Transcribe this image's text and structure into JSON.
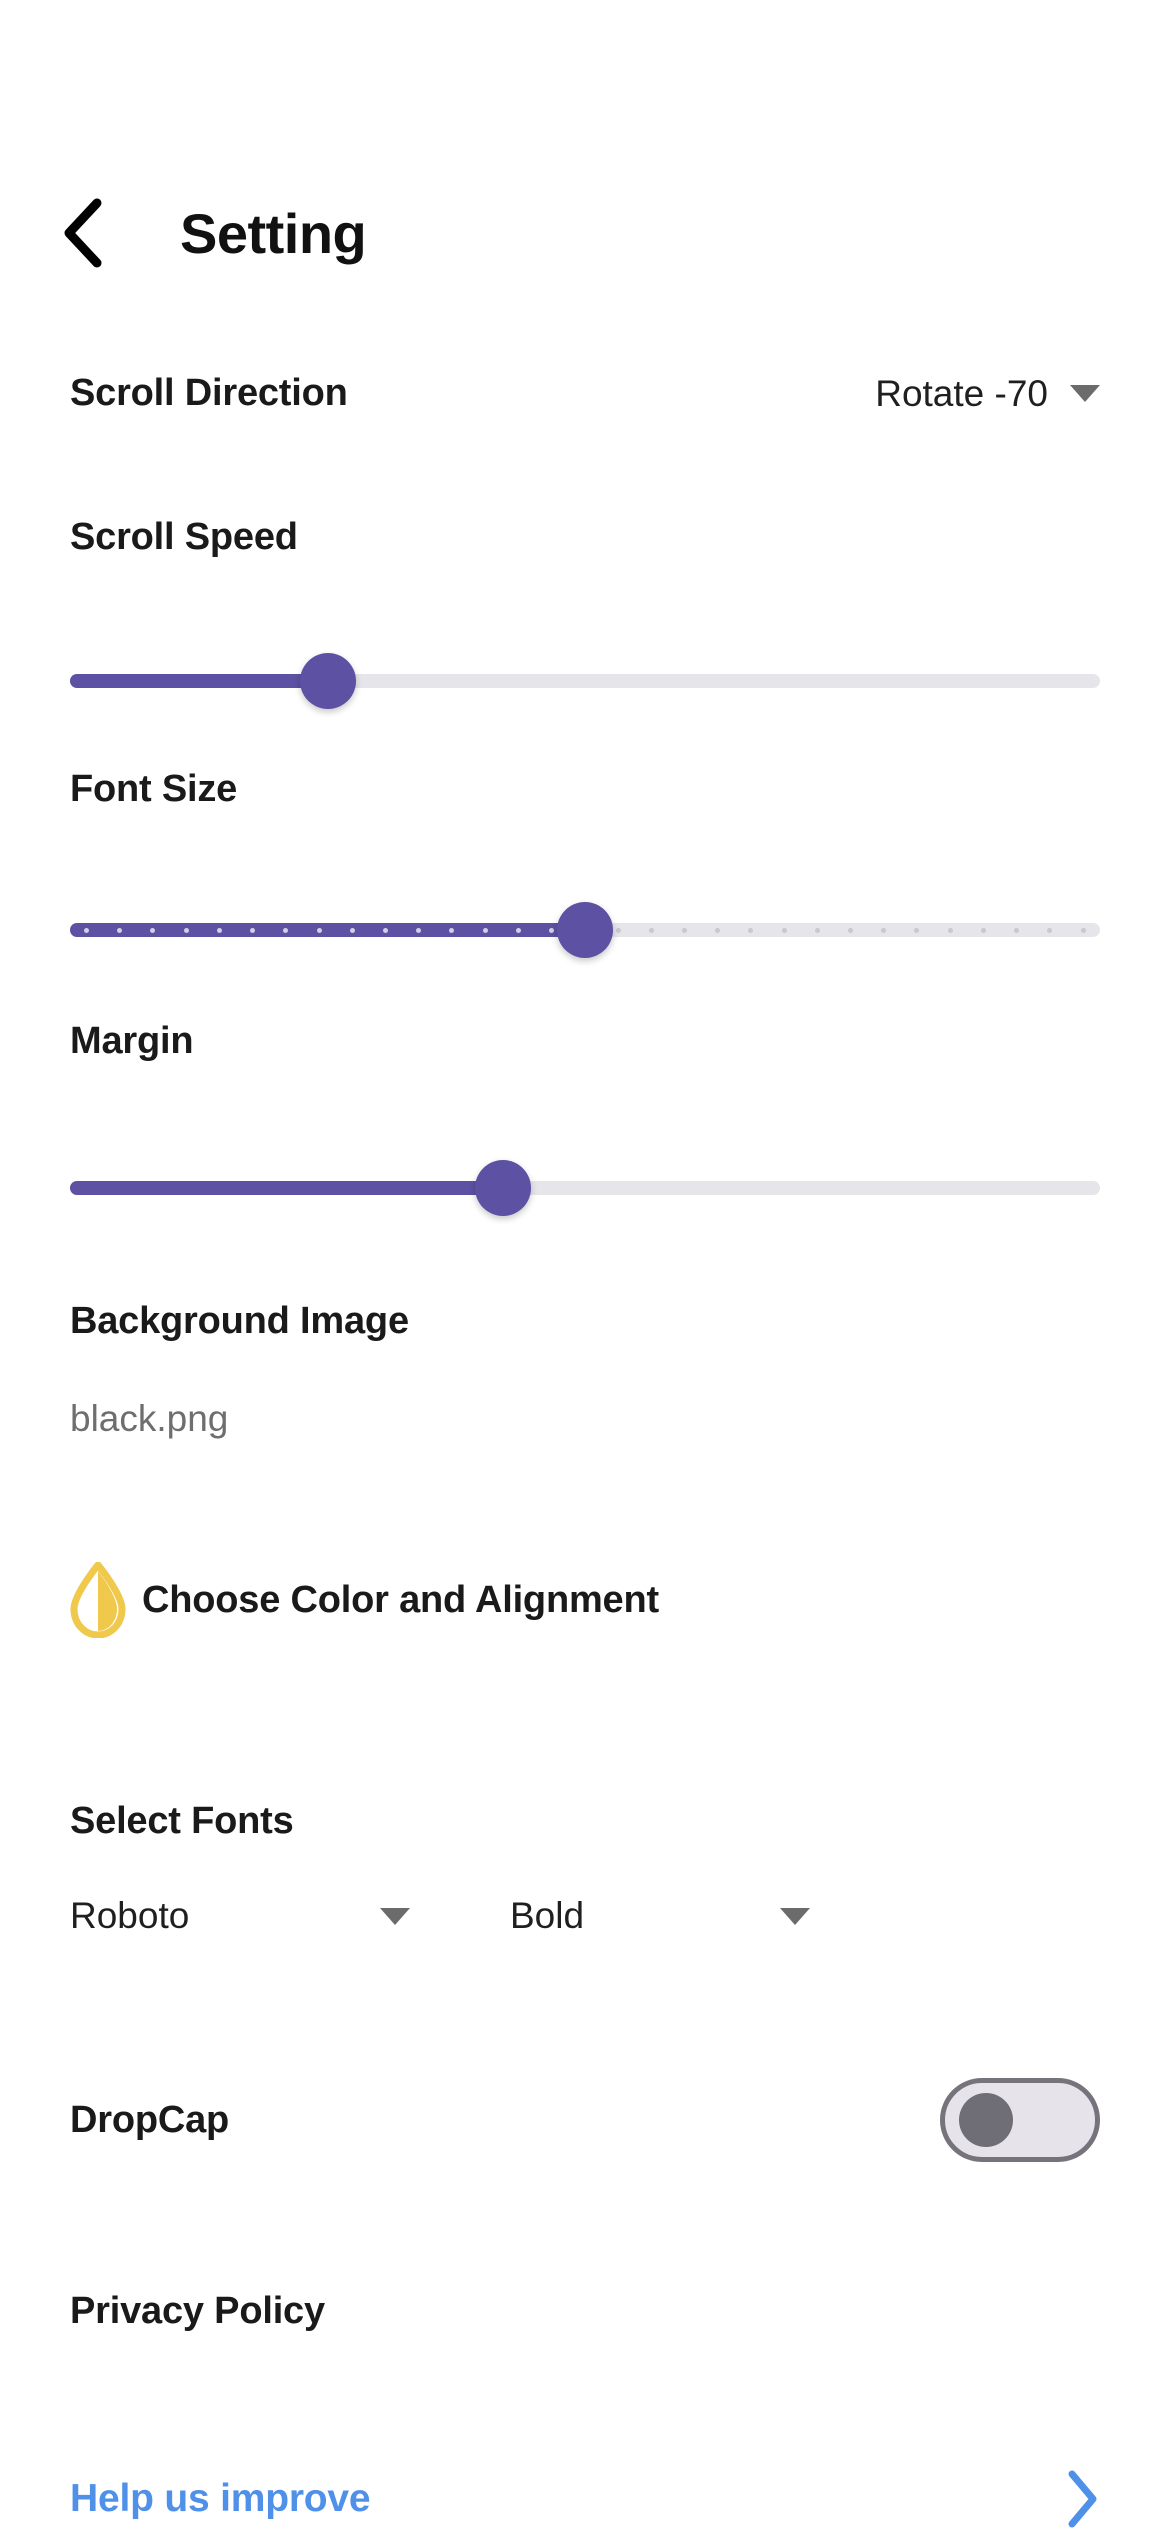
{
  "header": {
    "back_icon": "chevron-left-icon",
    "title": "Setting"
  },
  "settings": {
    "scroll_direction": {
      "label": "Scroll Direction",
      "value": "Rotate -70",
      "caret_icon": "chevron-down-icon"
    },
    "scroll_speed": {
      "label": "Scroll Speed",
      "percent": 25
    },
    "font_size": {
      "label": "Font Size",
      "percent": 50,
      "tick_count": 31
    },
    "margin": {
      "label": "Margin",
      "percent": 42
    },
    "background_image": {
      "label": "Background Image",
      "filename": "black.png"
    },
    "choose_color": {
      "icon": "droplet-icon",
      "icon_color": "#EFC84C",
      "label": "Choose Color and Alignment"
    },
    "select_fonts": {
      "label": "Select Fonts",
      "family": "Roboto",
      "weight": "Bold",
      "caret_icon": "chevron-down-icon"
    },
    "dropcap": {
      "label": "DropCap",
      "enabled": false
    },
    "privacy_policy": {
      "label": "Privacy Policy"
    },
    "help": {
      "label": "Help us improve",
      "chevron_icon": "chevron-right-icon"
    }
  },
  "colors": {
    "accent_purple": "#5D51A3",
    "track_grey": "#E6E5EA",
    "link_blue": "#4F90E8",
    "droplet_yellow": "#EFC84C",
    "text_dark": "#1A1A1A",
    "text_muted": "#6E6E6E"
  }
}
